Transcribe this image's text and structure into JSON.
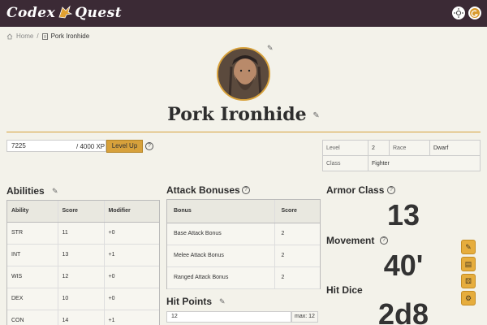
{
  "header": {
    "logo_left": "Codex",
    "logo_right": "Quest"
  },
  "breadcrumb": {
    "home": "Home",
    "sep": "/",
    "current": "Pork Ironhide"
  },
  "character": {
    "name": "Pork Ironhide"
  },
  "xp": {
    "value": "7225",
    "max": "/ 4000 XP",
    "level_up": "Level Up"
  },
  "info": {
    "level_label": "Level",
    "level_value": "2",
    "race_label": "Race",
    "race_value": "Dwarf",
    "class_label": "Class",
    "class_value": "Fighter"
  },
  "abilities": {
    "title": "Abilities",
    "headers": [
      "Ability",
      "Score",
      "Modifier"
    ],
    "rows": [
      [
        "STR",
        "11",
        "+0"
      ],
      [
        "INT",
        "13",
        "+1"
      ],
      [
        "WIS",
        "12",
        "+0"
      ],
      [
        "DEX",
        "10",
        "+0"
      ],
      [
        "CON",
        "14",
        "+1"
      ]
    ]
  },
  "attack": {
    "title": "Attack Bonuses",
    "headers": [
      "Bonus",
      "Score"
    ],
    "rows": [
      [
        "Base Attack Bonus",
        "2"
      ],
      [
        "Melee Attack Bonus",
        "2"
      ],
      [
        "Ranged Attack Bonus",
        "2"
      ]
    ]
  },
  "hit_points": {
    "title": "Hit Points",
    "value": "12",
    "max": "max: 12"
  },
  "armor_class": {
    "title": "Armor Class",
    "value": "13"
  },
  "movement": {
    "title": "Movement",
    "value": "40'"
  },
  "hit_dice": {
    "title": "Hit Dice",
    "value": "2d8"
  },
  "colors": {
    "accent": "#d7a13b",
    "topbar": "#3b2a35"
  }
}
